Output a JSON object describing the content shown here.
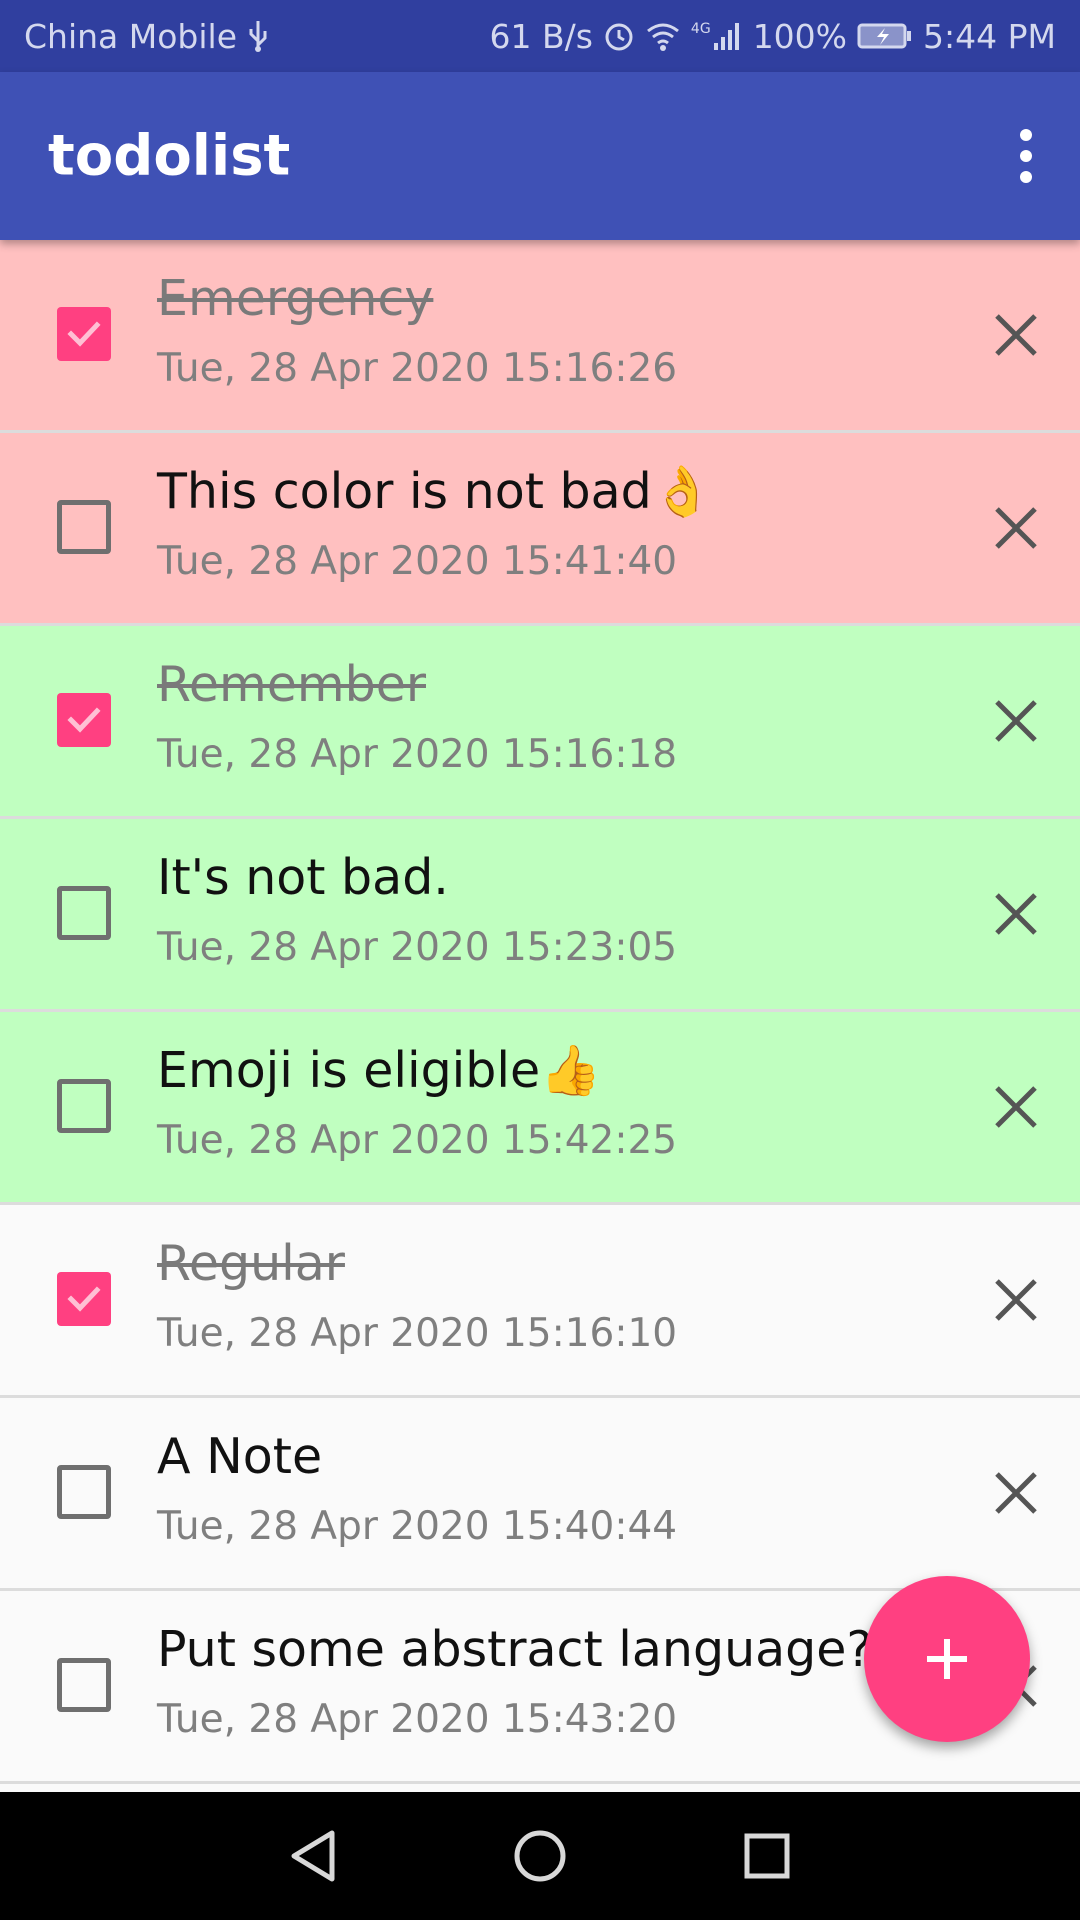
{
  "status_bar": {
    "carrier": "China Mobile",
    "speed": "61 B/s",
    "network": "4G",
    "battery": "100%",
    "time": "5:44 PM"
  },
  "app_bar": {
    "title": "todolist",
    "overflow_icon": "more-vert-icon"
  },
  "colors": {
    "status_bar": "#303f9f",
    "app_bar": "#3f51b5",
    "accent": "#ff4081",
    "priority_high": "#ffc0c0",
    "priority_medium": "#c0ffc0",
    "priority_regular": "#fafafa"
  },
  "todos": [
    {
      "title": "Emergency",
      "date": "Tue, 28 Apr 2020 15:16:26",
      "done": true,
      "bg": "#ffc0c0"
    },
    {
      "title": "This color is not bad👌",
      "date": "Tue, 28 Apr 2020 15:41:40",
      "done": false,
      "bg": "#ffc0c0"
    },
    {
      "title": "Remember",
      "date": "Tue, 28 Apr 2020 15:16:18",
      "done": true,
      "bg": "#c0ffc0"
    },
    {
      "title": "It's not bad.",
      "date": "Tue, 28 Apr 2020 15:23:05",
      "done": false,
      "bg": "#c0ffc0"
    },
    {
      "title": "Emoji is eligible👍",
      "date": "Tue, 28 Apr 2020 15:42:25",
      "done": false,
      "bg": "#c0ffc0"
    },
    {
      "title": "Regular",
      "date": "Tue, 28 Apr 2020 15:16:10",
      "done": true,
      "bg": "#fafafa"
    },
    {
      "title": "A Note",
      "date": "Tue, 28 Apr 2020 15:40:44",
      "done": false,
      "bg": "#fafafa"
    },
    {
      "title": "Put some abstract language??",
      "date": "Tue, 28 Apr 2020 15:43:20",
      "done": false,
      "bg": "#fafafa"
    }
  ],
  "fab": {
    "icon": "add-icon"
  },
  "nav_bar": {
    "back_icon": "back-icon",
    "home_icon": "home-icon",
    "recents_icon": "recents-icon"
  }
}
